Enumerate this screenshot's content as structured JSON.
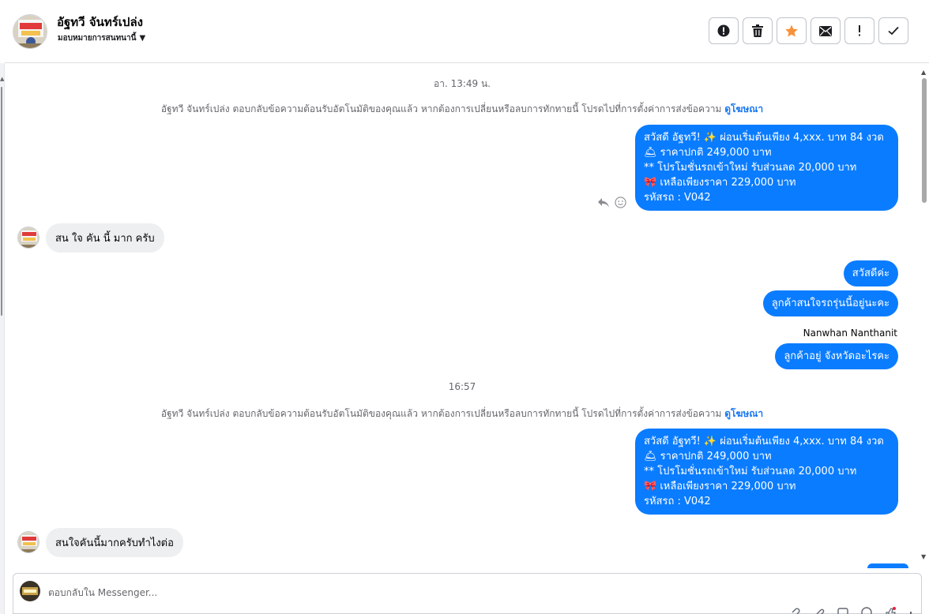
{
  "header": {
    "contact_name": "อัฐทวี จันทร์เปล่ง",
    "assign_label": "มอบหมายการสนทนานี้",
    "actions": [
      {
        "name": "mark-spam-button",
        "icon": "alert-circle-icon",
        "glyph": "!"
      },
      {
        "name": "delete-button",
        "icon": "trash-icon",
        "glyph": "🗑"
      },
      {
        "name": "star-button",
        "icon": "star-icon",
        "glyph": "★"
      },
      {
        "name": "mark-unread-button",
        "icon": "envelope-icon",
        "glyph": "✉"
      },
      {
        "name": "follow-up-button",
        "icon": "exclamation-icon",
        "glyph": "!"
      },
      {
        "name": "mark-done-button",
        "icon": "check-icon",
        "glyph": "✓"
      }
    ]
  },
  "conversation": {
    "time1": "อา. 13:49 น.",
    "system1": {
      "text": "อัฐทวี จันทร์เปล่ง ตอบกลับข้อความต้อนรับอัตโนมัติของคุณแล้ว หากต้องการเปลี่ยนหรือลบการทักทายนี้ โปรดไปที่การตั้งค่าการส่งข้อความ",
      "link": "ดูโฆษณา"
    },
    "promo1": {
      "line1": "สวัสดี อัฐทวี! ✨  ผ่อนเริ่มต้นเพียง 4,xxx. บาท 84 งวด",
      "line2": "🛎 ราคาปกติ 249,000 บาท",
      "line3": "** โปรโมชั่นรถเข้าใหม่ รับส่วนลด 20,000 บาท",
      "line4": "🎀  เหลือเพียงราคา 229,000 บาท",
      "line5": " รหัสรถ : V042"
    },
    "in1": "สน ใจ คัน นี้ มาก ครับ",
    "out1": "สวัสดีค่ะ",
    "out2": "ลูกค้าสนใจรถรุ่นนี้อยู่นะคะ",
    "sender_name": "Nanwhan Nanthanit",
    "out3": "ลูกค้าอยู่ จังหวัดอะไรคะ",
    "time2": "16:57",
    "system2": {
      "text": "อัฐทวี จันทร์เปล่ง ตอบกลับข้อความต้อนรับอัตโนมัติของคุณแล้ว หากต้องการเปลี่ยนหรือลบการทักทายนี้ โปรดไปที่การตั้งค่าการส่งข้อความ",
      "link": "ดูโฆษณา"
    },
    "promo2": {
      "line1": "สวัสดี อัฐทวี! ✨  ผ่อนเริ่มต้นเพียง 4,xxx. บาท 84 งวด",
      "line2": "🛎 ราคาปกติ 249,000 บาท",
      "line3": "** โปรโมชั่นรถเข้าใหม่ รับส่วนลด 20,000 บาท",
      "line4": "🎀  เหลือเพียงราคา 229,000 บาท",
      "line5": " รหัสรถ : V042"
    },
    "in2": "สนใจคันนี้มากครับทำไงต่อ"
  },
  "composer": {
    "placeholder": "ตอบกลับใน Messenger..."
  },
  "colors": {
    "outgoing_bubble": "#0a7cff",
    "incoming_bubble": "#eeeff1",
    "link": "#1877f2"
  }
}
